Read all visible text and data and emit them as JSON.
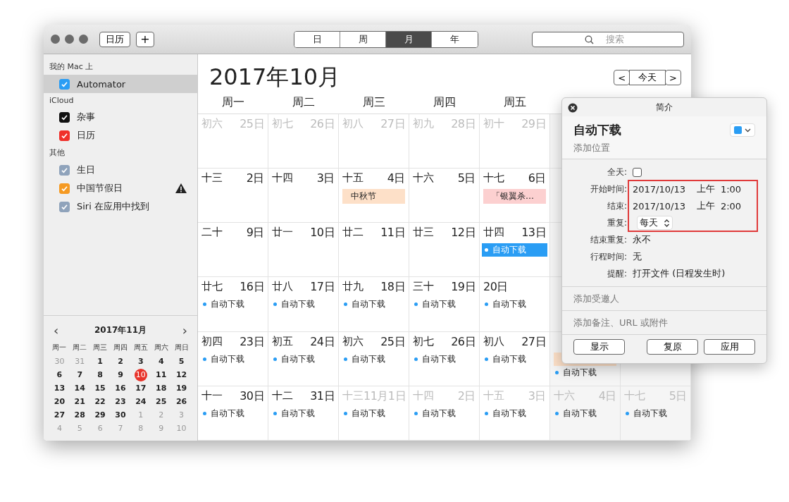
{
  "toolbar": {
    "buttons": [
      "日历",
      "+"
    ],
    "views": [
      {
        "label": "日",
        "selected": false
      },
      {
        "label": "周",
        "selected": false
      },
      {
        "label": "月",
        "selected": true
      },
      {
        "label": "年",
        "selected": false
      }
    ],
    "search": {
      "placeholder": "搜索"
    }
  },
  "sidebar": {
    "groups": [
      {
        "title": "我的 Mac 上",
        "items": [
          {
            "label": "Automator",
            "color": "#2a9df4",
            "checked": true,
            "selected": true,
            "warning": false
          }
        ]
      },
      {
        "title": "iCloud",
        "items": [
          {
            "label": "杂事",
            "color": "#111111",
            "checked": true,
            "selected": false,
            "warning": false
          },
          {
            "label": "日历",
            "color": "#f0302a",
            "checked": true,
            "selected": false,
            "warning": false
          }
        ]
      },
      {
        "title": "其他",
        "items": [
          {
            "label": "生日",
            "color": "#8fa3bb",
            "checked": true,
            "selected": false,
            "warning": false
          },
          {
            "label": "中国节假日",
            "color": "#f59a23",
            "checked": true,
            "selected": false,
            "warning": true
          },
          {
            "label": "Siri 在应用中找到",
            "color": "#8fa3bb",
            "checked": true,
            "selected": false,
            "warning": false
          }
        ]
      }
    ],
    "mini_calendar": {
      "title": "2017年11月",
      "prev": "‹",
      "next": "›",
      "weekdays": [
        "周一",
        "周二",
        "周三",
        "周四",
        "周五",
        "周六",
        "周日"
      ],
      "days": [
        {
          "d": "30",
          "dim": true
        },
        {
          "d": "31",
          "dim": true
        },
        {
          "d": "1"
        },
        {
          "d": "2"
        },
        {
          "d": "3"
        },
        {
          "d": "4"
        },
        {
          "d": "5"
        },
        {
          "d": "6"
        },
        {
          "d": "7"
        },
        {
          "d": "8"
        },
        {
          "d": "9"
        },
        {
          "d": "10",
          "today": true
        },
        {
          "d": "11"
        },
        {
          "d": "12"
        },
        {
          "d": "13"
        },
        {
          "d": "14"
        },
        {
          "d": "15"
        },
        {
          "d": "16"
        },
        {
          "d": "17"
        },
        {
          "d": "18"
        },
        {
          "d": "19"
        },
        {
          "d": "20"
        },
        {
          "d": "21"
        },
        {
          "d": "22"
        },
        {
          "d": "23"
        },
        {
          "d": "24"
        },
        {
          "d": "25"
        },
        {
          "d": "26"
        },
        {
          "d": "27"
        },
        {
          "d": "28"
        },
        {
          "d": "29"
        },
        {
          "d": "30"
        },
        {
          "d": "1",
          "dim": true
        },
        {
          "d": "2",
          "dim": true
        },
        {
          "d": "3",
          "dim": true
        },
        {
          "d": "4",
          "dim": true
        },
        {
          "d": "5",
          "dim": true
        },
        {
          "d": "6",
          "dim": true
        },
        {
          "d": "7",
          "dim": true
        },
        {
          "d": "8",
          "dim": true
        },
        {
          "d": "9",
          "dim": true
        },
        {
          "d": "10",
          "dim": true
        }
      ]
    }
  },
  "month": {
    "title": "2017年10月",
    "nav": {
      "prev": "<",
      "today": "今天",
      "next": ">"
    },
    "weekdays": [
      "周一",
      "周二",
      "周三",
      "周四",
      "周五"
    ],
    "weeks": [
      [
        {
          "lunar": "初六",
          "day": "25日",
          "dim": true
        },
        {
          "lunar": "初七",
          "day": "26日",
          "dim": true
        },
        {
          "lunar": "初八",
          "day": "27日",
          "dim": true
        },
        {
          "lunar": "初九",
          "day": "28日",
          "dim": true
        },
        {
          "lunar": "初十",
          "day": "29日",
          "dim": true
        }
      ],
      [
        {
          "lunar": "十三",
          "day": "2日"
        },
        {
          "lunar": "十四",
          "day": "3日"
        },
        {
          "lunar": "十五",
          "day": "4日",
          "events": [
            {
              "kind": "holiday",
              "title": "中秋节",
              "color": "#fde0c8"
            }
          ]
        },
        {
          "lunar": "十六",
          "day": "5日"
        },
        {
          "lunar": "十七",
          "day": "6日",
          "events": [
            {
              "kind": "holiday",
              "title": "「银翼杀…",
              "color": "#fcd0d0"
            }
          ]
        }
      ],
      [
        {
          "lunar": "二十",
          "day": "9日"
        },
        {
          "lunar": "廿一",
          "day": "10日"
        },
        {
          "lunar": "廿二",
          "day": "11日"
        },
        {
          "lunar": "廿三",
          "day": "12日"
        },
        {
          "lunar": "廿四",
          "day": "13日",
          "events": [
            {
              "kind": "timed",
              "title": "自动下载",
              "selected": true
            }
          ]
        }
      ],
      [
        {
          "lunar": "廿七",
          "day": "16日",
          "events": [
            {
              "kind": "timed",
              "title": "自动下载",
              "selected": false
            }
          ]
        },
        {
          "lunar": "廿八",
          "day": "17日",
          "events": [
            {
              "kind": "timed",
              "title": "自动下载",
              "selected": false
            }
          ]
        },
        {
          "lunar": "廿九",
          "day": "18日",
          "events": [
            {
              "kind": "timed",
              "title": "自动下载",
              "selected": false
            }
          ]
        },
        {
          "lunar": "三十",
          "day": "19日",
          "events": [
            {
              "kind": "timed",
              "title": "自动下载",
              "selected": false
            }
          ]
        },
        {
          "day": "20日",
          "events": [
            {
              "kind": "timed",
              "title": "自动下载",
              "selected": false
            }
          ]
        }
      ],
      [
        {
          "lunar": "初四",
          "day": "23日",
          "events": [
            {
              "kind": "timed",
              "title": "自动下载",
              "selected": false
            }
          ]
        },
        {
          "lunar": "初五",
          "day": "24日",
          "events": [
            {
              "kind": "timed",
              "title": "自动下载",
              "selected": false
            }
          ]
        },
        {
          "lunar": "初六",
          "day": "25日",
          "events": [
            {
              "kind": "timed",
              "title": "自动下载",
              "selected": false
            }
          ]
        },
        {
          "lunar": "初七",
          "day": "26日",
          "events": [
            {
              "kind": "timed",
              "title": "自动下载",
              "selected": false
            }
          ]
        },
        {
          "lunar": "初八",
          "day": "27日",
          "events": [
            {
              "kind": "timed",
              "title": "自动下载",
              "selected": false
            }
          ]
        },
        {
          "events": [
            {
              "kind": "holiday",
              "color": "#fde0c8"
            },
            {
              "kind": "timed",
              "title": "自动下载",
              "selected": false
            }
          ]
        }
      ],
      [
        {
          "lunar": "十一",
          "day": "30日",
          "events": [
            {
              "kind": "timed",
              "title": "自动下载",
              "selected": false
            }
          ]
        },
        {
          "lunar": "十二",
          "day": "31日",
          "events": [
            {
              "kind": "timed",
              "title": "自动下载",
              "selected": false
            }
          ]
        },
        {
          "lunar": "十三",
          "day": "11月1日",
          "dim": true,
          "events": [
            {
              "kind": "timed",
              "title": "自动下载",
              "selected": false
            }
          ]
        },
        {
          "lunar": "十四",
          "day": "2日",
          "dim": true,
          "events": [
            {
              "kind": "timed",
              "title": "自动下载",
              "selected": false
            }
          ]
        },
        {
          "lunar": "十五",
          "day": "3日",
          "dim": true,
          "events": [
            {
              "kind": "timed",
              "title": "自动下载",
              "selected": false
            }
          ]
        },
        {
          "lunar": "十六",
          "day": "4日",
          "dim": true,
          "events": [
            {
              "kind": "timed",
              "title": "自动下载",
              "selected": false
            }
          ]
        },
        {
          "lunar": "十七",
          "day": "5日",
          "dim": true,
          "events": [
            {
              "kind": "timed",
              "title": "自动下载",
              "selected": false
            }
          ]
        }
      ]
    ]
  },
  "popover": {
    "title": "简介",
    "event_title": "自动下载",
    "location": {
      "placeholder": "添加位置"
    },
    "color": "#2a9df4",
    "fields": [
      {
        "label": "全天:",
        "kind": "checkbox",
        "checked": false,
        "highlighted": false
      },
      {
        "label": "开始时间:",
        "kind": "datetime",
        "date": "2017/10/13",
        "ampm": "上午",
        "time": "1:00",
        "highlighted": true
      },
      {
        "label": "结束:",
        "kind": "datetime",
        "date": "2017/10/13",
        "ampm": "上午",
        "time": "2:00",
        "highlighted": true
      },
      {
        "label": "重复:",
        "kind": "popup",
        "value": "每天",
        "highlighted": true
      },
      {
        "label": "结束重复:",
        "kind": "text",
        "value": "永不",
        "highlighted": false
      },
      {
        "label": "行程时间:",
        "kind": "text",
        "value": "无",
        "highlighted": false
      },
      {
        "label": "提醒:",
        "kind": "text",
        "value": "打开文件 (日程发生时)",
        "highlighted": false
      }
    ],
    "invitees": {
      "placeholder": "添加受邀人"
    },
    "notes": {
      "placeholder": "添加备注、URL 或附件"
    },
    "buttons": [
      "显示",
      "复原",
      "应用"
    ]
  }
}
